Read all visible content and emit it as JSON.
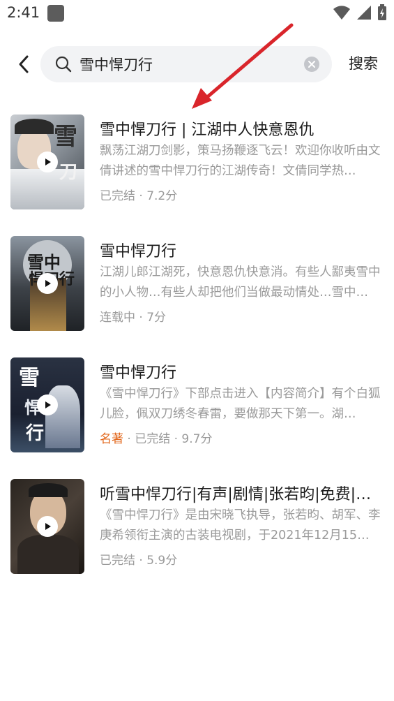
{
  "status_bar": {
    "time": "2:41",
    "icons": [
      "app-icon",
      "wifi-icon",
      "signal-icon",
      "battery-icon"
    ]
  },
  "search": {
    "query": "雪中悍刀行",
    "button_label": "搜索"
  },
  "results": [
    {
      "title": "雪中悍刀行 | 江湖中人快意恩仇",
      "description": "飘荡江湖刀剑影，策马扬鞭逐飞云！欢迎你收听由文倩讲述的雪中悍刀行的江湖传奇！文倩同学热…",
      "tag": "",
      "meta": "已完结 · 7.2分"
    },
    {
      "title": "雪中悍刀行",
      "description": "江湖儿郎江湖死，快意恩仇快意消。有些人鄙夷雪中的小人物…有些人却把他们当做最动情处…雪中…",
      "tag": "",
      "meta": "连载中 · 7分"
    },
    {
      "title": "雪中悍刀行",
      "description": "《雪中悍刀行》下部点击进入【内容简介】有个白狐儿脸，佩双刀绣冬春雷，要做那天下第一。湖…",
      "tag": "名著",
      "meta": " · 已完结 · 9.7分"
    },
    {
      "title": "听雪中悍刀行|有声|剧情|张若昀|免费|烽…",
      "description": "《雪中悍刀行》是由宋晓飞执导，张若昀、胡军、李庚希领衔主演的古装电视剧，于2021年12月15…",
      "tag": "",
      "meta": "已完结 · 5.9分"
    }
  ],
  "colors": {
    "accent_tag": "#e2661a",
    "annotation_arrow": "#d9252b",
    "search_bg": "#f2f3f5"
  }
}
